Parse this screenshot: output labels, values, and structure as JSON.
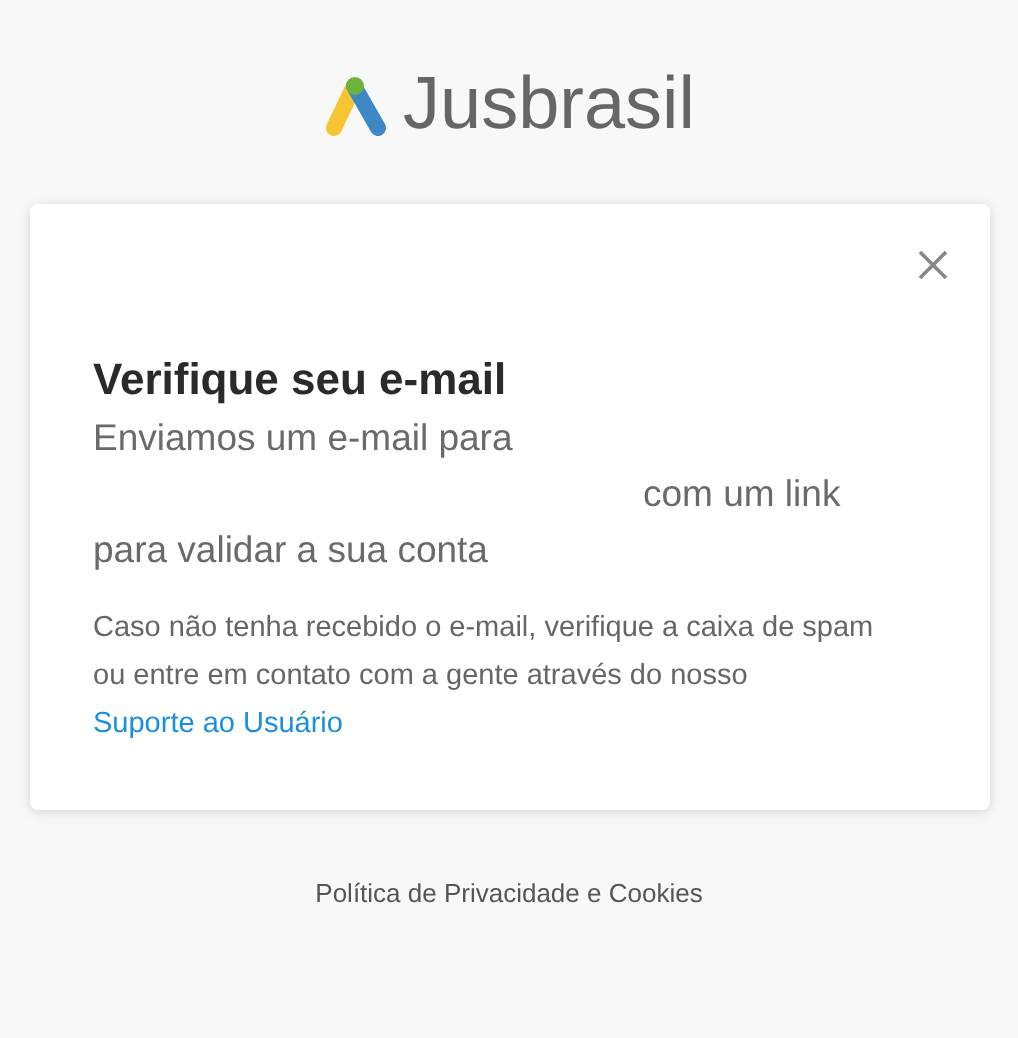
{
  "logo": {
    "text": "Jusbrasil"
  },
  "card": {
    "title": "Verifique seu e-mail",
    "message_lines": [
      "Enviamos um e-mail para",
      "com um link",
      "para validar a sua conta"
    ],
    "help_text": "Caso não tenha recebido o e-mail, verifique a caixa de spam ou entre em contato com a gente através do nosso",
    "support_link": "Suporte ao Usuário"
  },
  "footer_link": "Política de Privacidade e Cookies"
}
